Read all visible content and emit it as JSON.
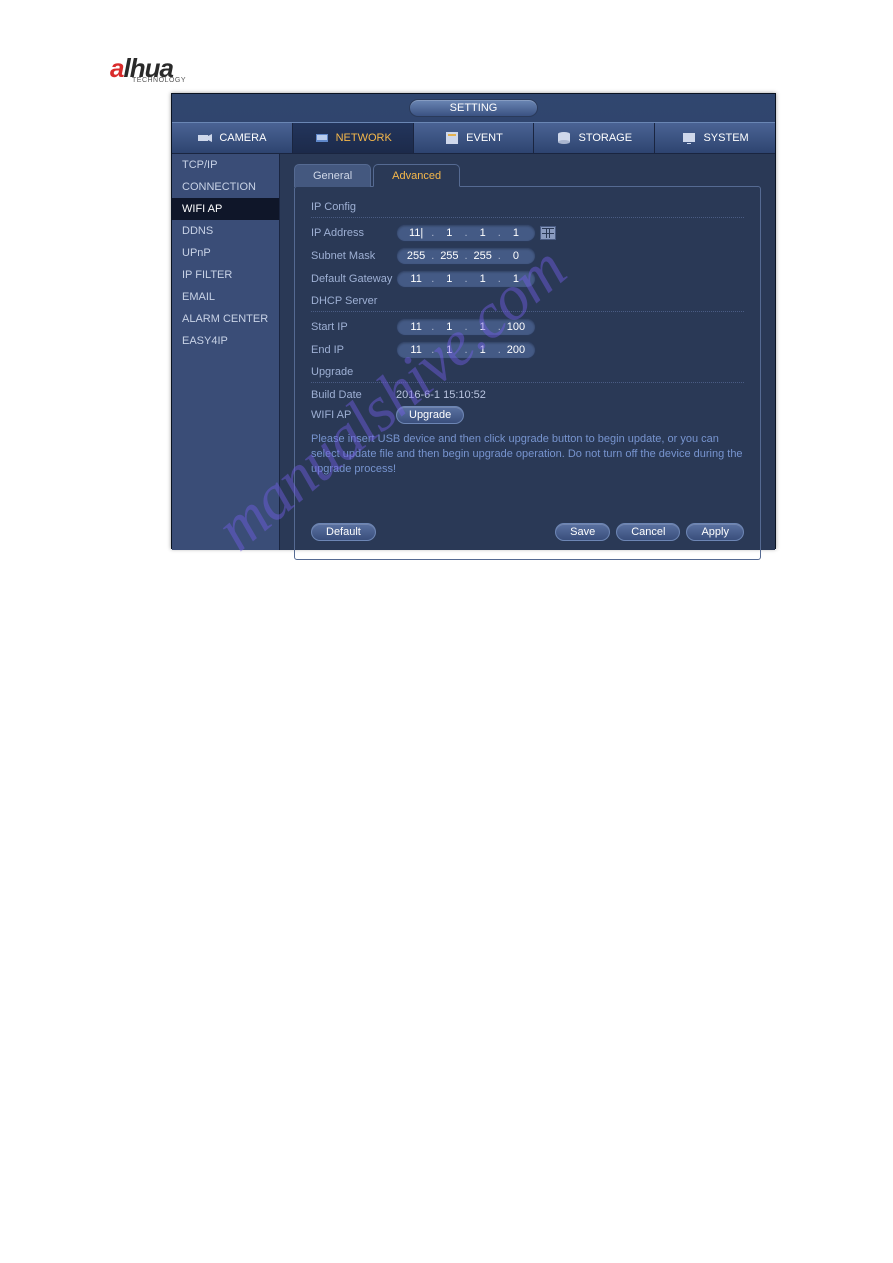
{
  "logo": {
    "brand_a": "a",
    "brand_lhua": "lhua",
    "sub": "TECHNOLOGY"
  },
  "title": "SETTING",
  "main_tabs": {
    "camera": "CAMERA",
    "network": "NETWORK",
    "event": "EVENT",
    "storage": "STORAGE",
    "system": "SYSTEM"
  },
  "sidebar": {
    "items": [
      "TCP/IP",
      "CONNECTION",
      "WIFI AP",
      "DDNS",
      "UPnP",
      "IP FILTER",
      "EMAIL",
      "ALARM CENTER",
      "EASY4IP"
    ]
  },
  "sub_tabs": {
    "general": "General",
    "advanced": "Advanced"
  },
  "sections": {
    "ip_config": "IP Config",
    "dhcp_server": "DHCP Server",
    "upgrade": "Upgrade"
  },
  "labels": {
    "ip_address": "IP Address",
    "subnet_mask": "Subnet Mask",
    "default_gateway": "Default Gateway",
    "start_ip": "Start IP",
    "end_ip": "End IP",
    "build_date": "Build Date",
    "wifi_ap": "WIFI AP"
  },
  "values": {
    "ip_address": [
      "11|",
      "1",
      "1",
      "1"
    ],
    "subnet_mask": [
      "255",
      "255",
      "255",
      "0"
    ],
    "default_gateway": [
      "11",
      "1",
      "1",
      "1"
    ],
    "start_ip": [
      "11",
      "1",
      "1",
      "100"
    ],
    "end_ip": [
      "11",
      "1",
      "1",
      "200"
    ],
    "build_date": "2016-6-1 15:10:52"
  },
  "buttons": {
    "upgrade": "Upgrade",
    "default": "Default",
    "save": "Save",
    "cancel": "Cancel",
    "apply": "Apply"
  },
  "note": "Please insert USB device and then click upgrade button to begin update, or you can select update file and then begin upgrade operation. Do not turn off the device during the upgrade process!",
  "watermark": "manualshive.com"
}
